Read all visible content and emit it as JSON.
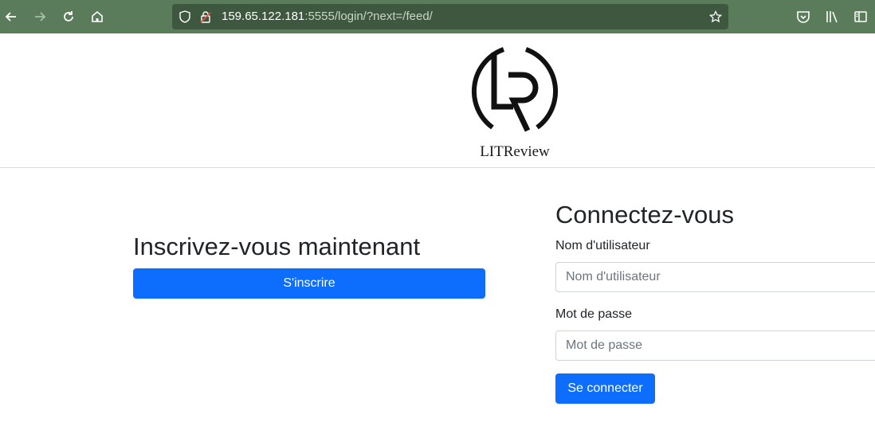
{
  "browser": {
    "url_host": "159.65.122.181",
    "url_rest": ":5555/login/?next=/feed/"
  },
  "brand": {
    "name": "LITReview"
  },
  "signup": {
    "title": "Inscrivez-vous maintenant",
    "button_label": "S'inscrire"
  },
  "login": {
    "title": "Connectez-vous",
    "username_label": "Nom d'utilisateur",
    "username_placeholder": "Nom d'utilisateur",
    "password_label": "Mot de passe",
    "password_placeholder": "Mot de passe",
    "submit_label": "Se connecter"
  },
  "colors": {
    "toolbar": "#5b7c5a",
    "primary": "#0d6efd"
  }
}
